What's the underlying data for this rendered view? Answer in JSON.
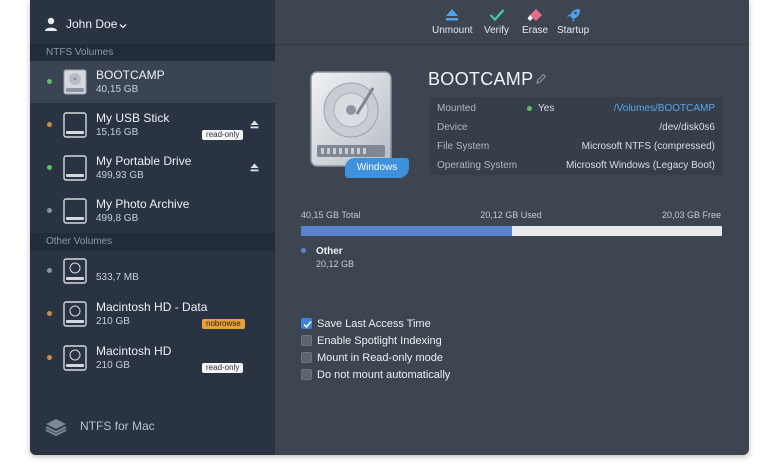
{
  "user": {
    "name": "John Doe"
  },
  "sections": {
    "ntfs": "NTFS Volumes",
    "other": "Other Volumes"
  },
  "volumes": [
    {
      "name": "BOOTCAMP",
      "size": "40,15 GB",
      "status": "green",
      "selected": true
    },
    {
      "name": "My USB Stick",
      "size": "15,16 GB",
      "status": "orange",
      "badge": "read-only",
      "eject": true
    },
    {
      "name": "My Portable Drive",
      "size": "499,93 GB",
      "status": "green",
      "eject": true
    },
    {
      "name": "My Photo Archive",
      "size": "499,8 GB",
      "status": "gray"
    }
  ],
  "other_volumes": [
    {
      "name": "",
      "size": "533,7 MB",
      "status": "gray"
    },
    {
      "name": "Macintosh HD - Data",
      "size": "210 GB",
      "status": "orange",
      "badge": "nobrowse"
    },
    {
      "name": "Macintosh HD",
      "size": "210 GB",
      "status": "orange",
      "badge": "read-only"
    }
  ],
  "brand": "NTFS for Mac",
  "toolbar": {
    "unmount": "Unmount",
    "verify": "Verify",
    "erase": "Erase",
    "startup": "Startup"
  },
  "detail": {
    "title": "BOOTCAMP",
    "tag": "Windows",
    "info": {
      "mounted_label": "Mounted",
      "mounted_value": "Yes",
      "mount_path": "/Volumes/BOOTCAMP",
      "device_label": "Device",
      "device_value": "/dev/disk0s6",
      "fs_label": "File System",
      "fs_value": "Microsoft NTFS (compressed)",
      "os_label": "Operating System",
      "os_value": "Microsoft Windows (Legacy Boot)"
    },
    "usage": {
      "total": "40,15 GB Total",
      "used": "20,12 GB Used",
      "free": "20,03 GB Free",
      "used_fraction": 0.501
    },
    "legend": {
      "name": "Other",
      "size": "20,12 GB"
    },
    "options": [
      {
        "label": "Save Last Access Time",
        "checked": true
      },
      {
        "label": "Enable Spotlight Indexing",
        "checked": false
      },
      {
        "label": "Mount in Read-only mode",
        "checked": false
      },
      {
        "label": "Do not mount automatically",
        "checked": false
      }
    ]
  },
  "colors": {
    "accent": "#3f91dd",
    "bar_fill": "#5a83cf",
    "green": "#5cc15d",
    "orange": "#c98e44"
  }
}
